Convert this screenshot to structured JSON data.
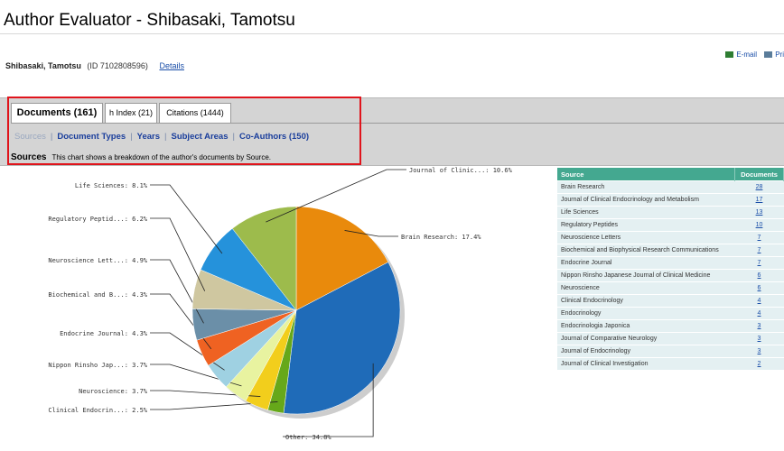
{
  "window": {
    "title": "Author Evaluator - Shibasaki, Tamotsu"
  },
  "author": {
    "name": "Shibasaki, Tamotsu",
    "id_text": "(ID 7102808596)",
    "details_link": "Details"
  },
  "toolbar": {
    "email_label": "E-mail",
    "print_label": "Pri"
  },
  "tabs": [
    {
      "label": "Documents (161)",
      "active": true
    },
    {
      "label": "h Index (21)",
      "active": false
    },
    {
      "label": "Citations (1444)",
      "active": false
    }
  ],
  "subnav": [
    {
      "label": "Sources",
      "current": true
    },
    {
      "label": "Document Types",
      "current": false
    },
    {
      "label": "Years",
      "current": false
    },
    {
      "label": "Subject Areas",
      "current": false
    },
    {
      "label": "Co-Authors (150)",
      "current": false
    }
  ],
  "sources_heading": "Sources",
  "sources_description": "This chart shows a breakdown of the author's documents by Source.",
  "colors": {
    "highlight_border": "#e0141c",
    "table_header": "#44a890",
    "link": "#1a4ea8"
  },
  "chart_data": {
    "type": "pie",
    "slices": [
      {
        "label": "Brain Research",
        "value": 17.4,
        "display": "Brain Research: 17.4%",
        "color": "#e98a0c"
      },
      {
        "label": "Other",
        "value": 34.8,
        "display": "Other: 34.8%",
        "color": "#1f6bb8"
      },
      {
        "label": "Clinical Endocrin...",
        "value": 2.5,
        "display": "Clinical Endocrin...: 2.5%",
        "color": "#66a81a"
      },
      {
        "label": "Neuroscience",
        "value": 3.7,
        "display": "Neuroscience: 3.7%",
        "color": "#f2ce1c"
      },
      {
        "label": "Nippon Rinsho Jap...",
        "value": 3.7,
        "display": "Nippon Rinsho Jap...: 3.7%",
        "color": "#e8f3a0"
      },
      {
        "label": "Endocrine Journal",
        "value": 4.3,
        "display": "Endocrine Journal: 4.3%",
        "color": "#9fd1e2"
      },
      {
        "label": "Biochemical and B...",
        "value": 4.3,
        "display": "Biochemical and B...: 4.3%",
        "color": "#ef6222"
      },
      {
        "label": "Neuroscience Lett...",
        "value": 4.9,
        "display": "Neuroscience Lett...: 4.9%",
        "color": "#6b8fa8"
      },
      {
        "label": "Regulatory Peptid...",
        "value": 6.2,
        "display": "Regulatory Peptid...: 6.2%",
        "color": "#cfc7a0"
      },
      {
        "label": "Life Sciences",
        "value": 8.1,
        "display": "Life Sciences: 8.1%",
        "color": "#2592db"
      },
      {
        "label": "Journal of Clinic...",
        "value": 10.6,
        "display": "Journal of Clinic...: 10.6%",
        "color": "#9dbb4c"
      }
    ]
  },
  "table": {
    "headers": [
      "Source",
      "Documents"
    ],
    "rows": [
      [
        "Brain Research",
        "28"
      ],
      [
        "Journal of Clinical Endocrinology and Metabolism",
        "17"
      ],
      [
        "Life Sciences",
        "13"
      ],
      [
        "Regulatory Peptides",
        "10"
      ],
      [
        "Neuroscience Letters",
        "7"
      ],
      [
        "Biochemical and Biophysical Research Communications",
        "7"
      ],
      [
        "Endocrine Journal",
        "7"
      ],
      [
        "Nippon Rinsho Japanese Journal of Clinical Medicine",
        "6"
      ],
      [
        "Neuroscience",
        "6"
      ],
      [
        "Clinical Endocrinology",
        "4"
      ],
      [
        "Endocrinology",
        "4"
      ],
      [
        "Endocrinologia Japonica",
        "3"
      ],
      [
        "Journal of Comparative Neurology",
        "3"
      ],
      [
        "Journal of Endocrinology",
        "3"
      ],
      [
        "Journal of Clinical Investigation",
        "2"
      ]
    ]
  }
}
